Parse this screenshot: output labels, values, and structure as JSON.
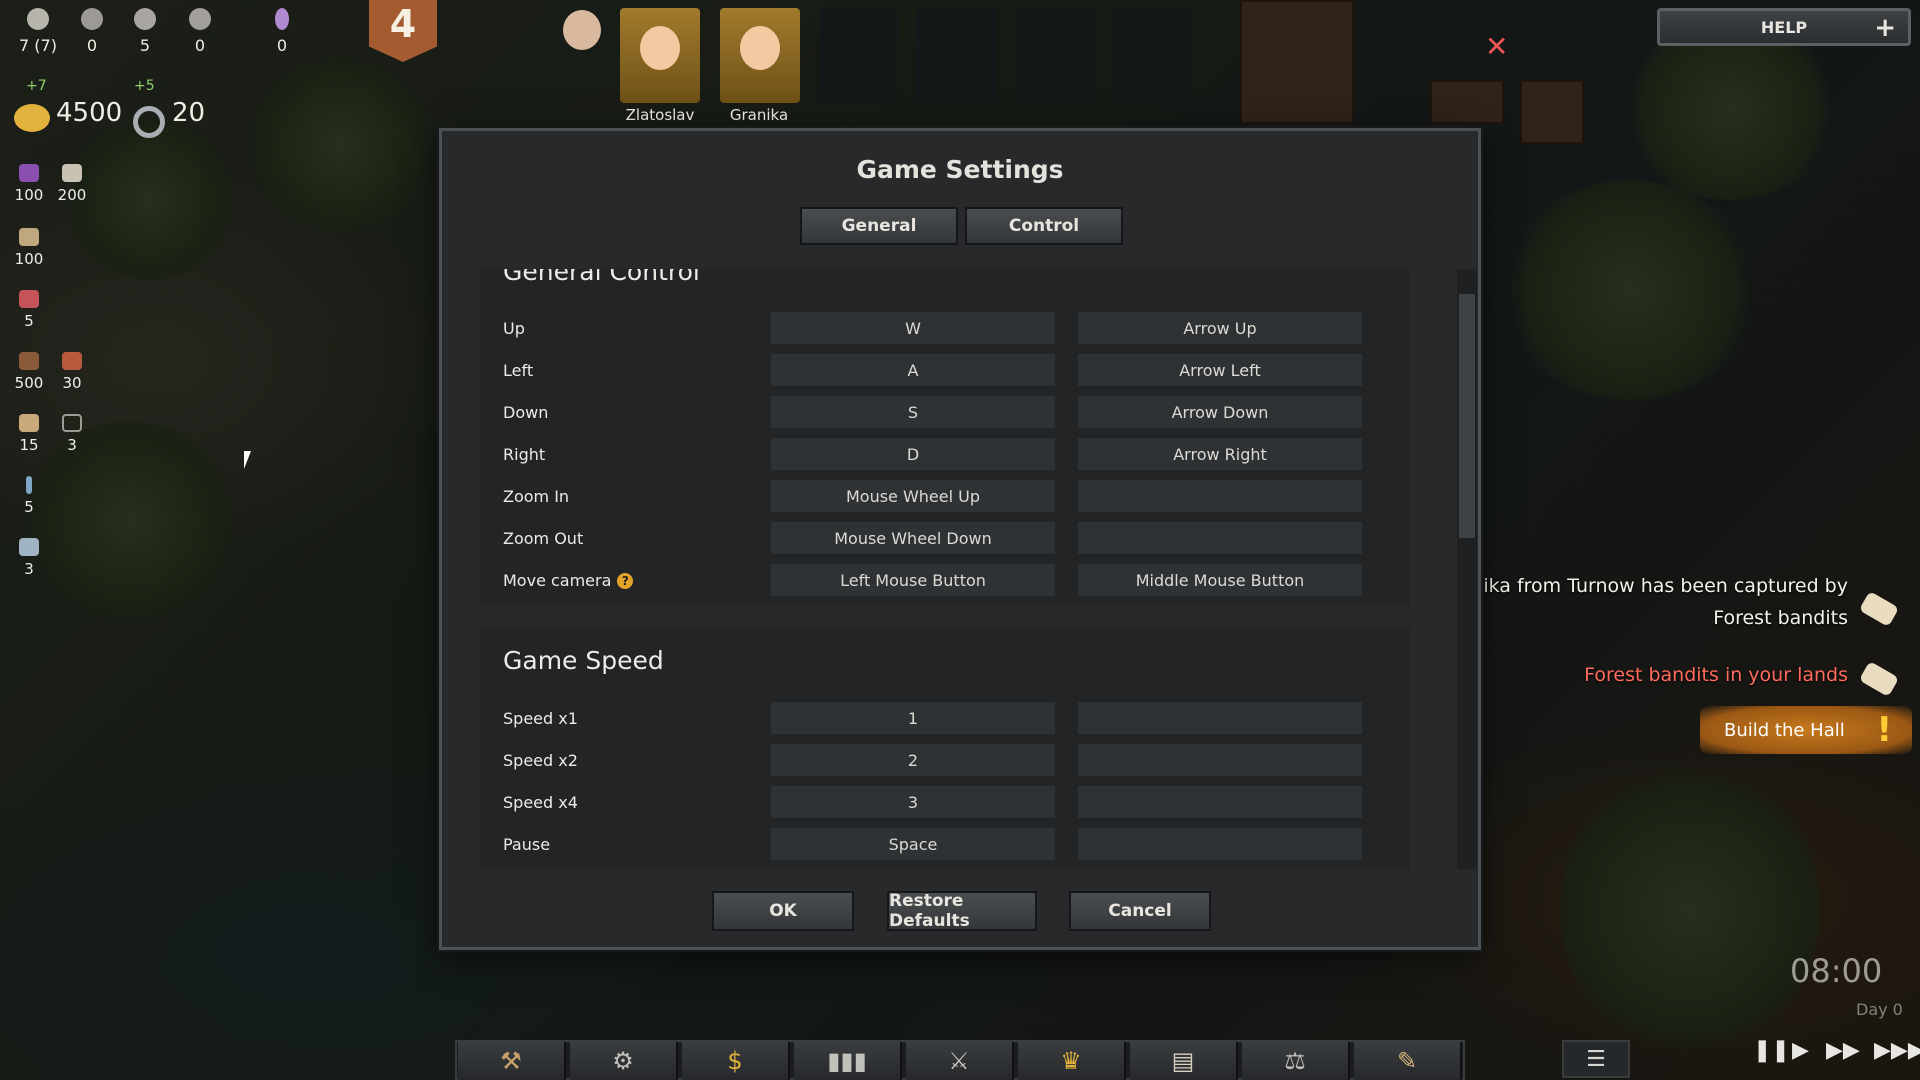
{
  "hud": {
    "population": [
      {
        "icon": "person-icon",
        "value": "7 (7)"
      },
      {
        "icon": "worker-icon",
        "value": "0"
      },
      {
        "icon": "soldier-icon",
        "value": "5"
      },
      {
        "icon": "sick-person-icon",
        "value": "0"
      },
      {
        "icon": "grave-cross-icon",
        "value": "0"
      }
    ],
    "gold_bonus": "+7",
    "gold": "4500",
    "influence_bonus": "+5",
    "influence": "20",
    "level": "4",
    "resources": [
      {
        "icon": "berries-icon",
        "value": "100"
      },
      {
        "icon": "stone-icon",
        "value": "200"
      },
      {
        "icon": "grain-sack-icon",
        "value": "100"
      },
      {
        "icon": "meat-icon",
        "value": "5"
      },
      {
        "icon": "logs-icon",
        "value": "500"
      },
      {
        "icon": "bricks-icon",
        "value": "30"
      },
      {
        "icon": "planks-icon",
        "value": "15"
      },
      {
        "icon": "bow-icon",
        "value": "3"
      },
      {
        "icon": "spear-icon",
        "value": "5"
      },
      {
        "icon": "armor-icon",
        "value": "3"
      }
    ],
    "characters": [
      {
        "name": "Zlatoslav"
      },
      {
        "name": "Granika"
      }
    ],
    "help_label": "HELP",
    "help_plus": "+"
  },
  "dialog": {
    "title": "Game Settings",
    "tabs": [
      "General",
      "Control"
    ],
    "sections": [
      {
        "title": "General Control",
        "rows": [
          {
            "label": "Up",
            "key1": "W",
            "key2": "Arrow Up"
          },
          {
            "label": "Left",
            "key1": "A",
            "key2": "Arrow Left"
          },
          {
            "label": "Down",
            "key1": "S",
            "key2": "Arrow Down"
          },
          {
            "label": "Right",
            "key1": "D",
            "key2": "Arrow Right"
          },
          {
            "label": "Zoom In",
            "key1": "Mouse Wheel Up",
            "key2": ""
          },
          {
            "label": "Zoom Out",
            "key1": "Mouse Wheel Down",
            "key2": ""
          },
          {
            "label": "Move camera",
            "key1": "Left Mouse Button",
            "key2": "Middle Mouse Button",
            "help": "?"
          }
        ]
      },
      {
        "title": "Game Speed",
        "rows": [
          {
            "label": "Speed x1",
            "key1": "1",
            "key2": ""
          },
          {
            "label": "Speed x2",
            "key1": "2",
            "key2": ""
          },
          {
            "label": "Speed x4",
            "key1": "3",
            "key2": ""
          },
          {
            "label": "Pause",
            "key1": "Space",
            "key2": ""
          }
        ]
      }
    ],
    "buttons": {
      "ok": "OK",
      "restore": "Restore Defaults",
      "cancel": "Cancel"
    }
  },
  "notifications": {
    "captured_line1": "anika from Turnow has been captured by",
    "captured_line2": "Forest bandits",
    "bandits": "Forest bandits in your lands",
    "quest": "Build the Hall",
    "quest_mark": "!"
  },
  "time": {
    "clock": "08:00",
    "day": "Day 0"
  },
  "bottom_bar": [
    "hammer-icon",
    "gear-icon",
    "money-bag-icon",
    "bar-chart-icon",
    "crossed-swords-icon",
    "crown-icon",
    "book-icon",
    "scales-icon",
    "map-quill-icon"
  ],
  "colors": {
    "accent_orange": "#c6791c",
    "alert_red": "#ff6b5c",
    "bonus_green": "#8fd06a"
  }
}
